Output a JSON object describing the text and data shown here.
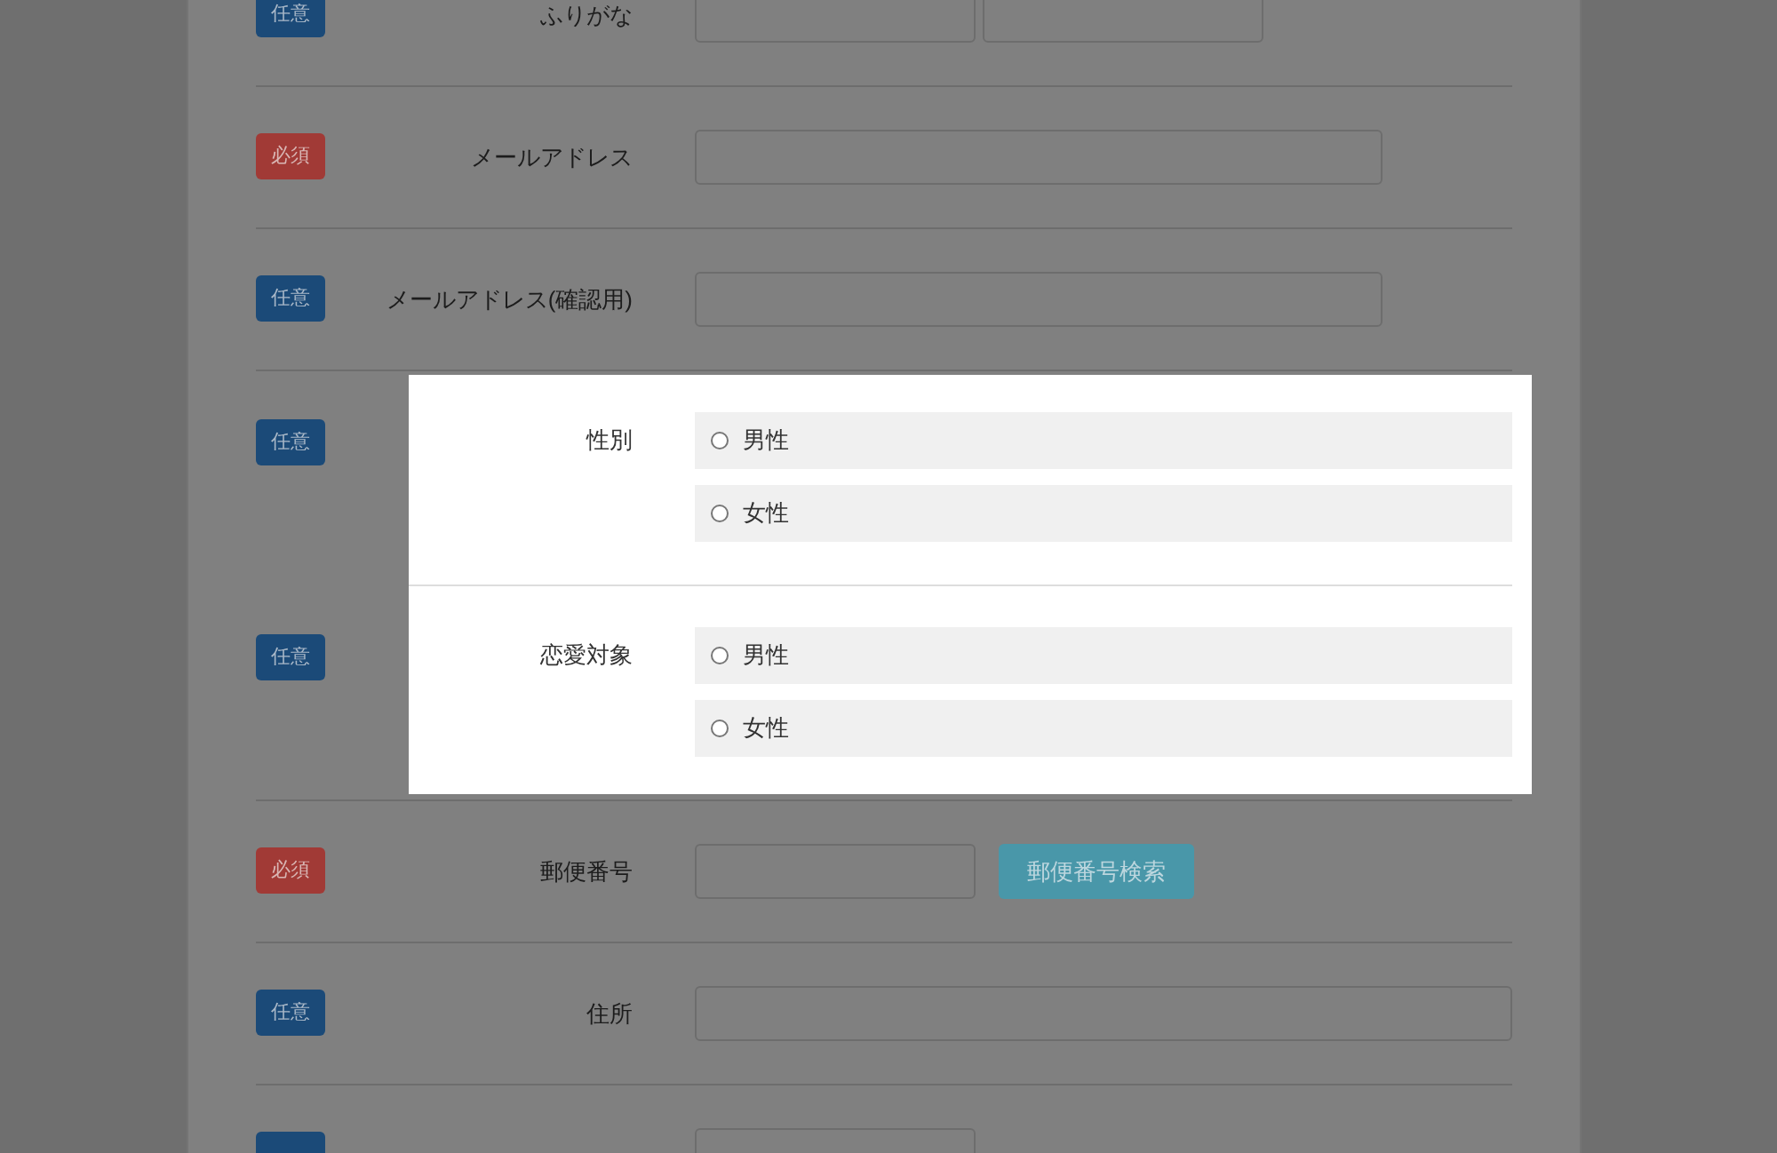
{
  "sections": [
    {
      "highlighted": false,
      "rows": [
        {
          "badge": {
            "text": "任意",
            "kind": "optional"
          },
          "label": "ふりがな",
          "kind": "pair"
        },
        {
          "badge": {
            "text": "必須",
            "kind": "required"
          },
          "label": "メールアドレス",
          "kind": "medium"
        },
        {
          "badge": {
            "text": "任意",
            "kind": "optional"
          },
          "label": "メールアドレス(確認用)",
          "kind": "medium"
        }
      ]
    },
    {
      "highlighted": true,
      "rows": [
        {
          "badge": {
            "text": "任意",
            "kind": "optional"
          },
          "label": "性別",
          "kind": "radio",
          "options": [
            {
              "label": "男性",
              "selected": false
            },
            {
              "label": "女性",
              "selected": false
            }
          ]
        },
        {
          "badge": {
            "text": "任意",
            "kind": "optional"
          },
          "label": "恋愛対象",
          "kind": "radio",
          "options": [
            {
              "label": "男性",
              "selected": false
            },
            {
              "label": "女性",
              "selected": false
            }
          ]
        }
      ]
    },
    {
      "highlighted": false,
      "rows": [
        {
          "badge": {
            "text": "必須",
            "kind": "required"
          },
          "label": "郵便番号",
          "kind": "zip",
          "button": "郵便番号検索"
        },
        {
          "badge": {
            "text": "任意",
            "kind": "optional"
          },
          "label": "住所",
          "kind": "long"
        },
        {
          "badge": {
            "kind": "optional"
          },
          "kind": "short"
        }
      ]
    }
  ]
}
